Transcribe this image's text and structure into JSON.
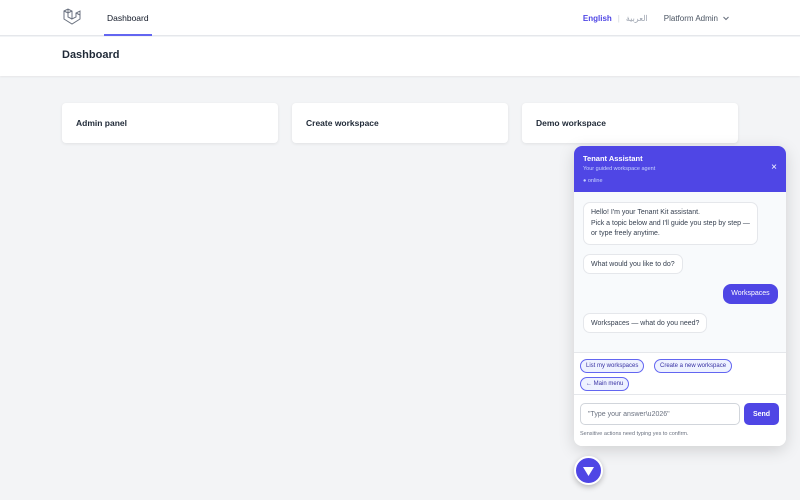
{
  "nav": {
    "dashboard_label": "Dashboard",
    "lang_en": "English",
    "lang_ar": "العربية",
    "user_name": "Platform Admin"
  },
  "header": {
    "title": "Dashboard"
  },
  "cards": [
    {
      "label": "Admin panel"
    },
    {
      "label": "Create workspace"
    },
    {
      "label": "Demo workspace"
    }
  ],
  "chat": {
    "title": "Tenant Assistant",
    "subtitle": "Your guided workspace agent",
    "status": "● online",
    "messages": [
      "Hello! I'm your Tenant Kit assistant.\nPick a topic below and I'll guide you step by step — or type freely anytime.",
      "What would you like to do?",
      "Workspaces",
      "Workspaces — what do you need?"
    ],
    "chips": [
      "List my workspaces",
      "Create a new workspace",
      "← Main menu"
    ],
    "input_placeholder": "\"Type your answer\\u2026\"",
    "send_label": "Send",
    "foot_note": "Sensitive actions need typing yes to confirm."
  },
  "colors": {
    "accent": "#4f46e5",
    "chip_bg": "#eef2ff"
  }
}
